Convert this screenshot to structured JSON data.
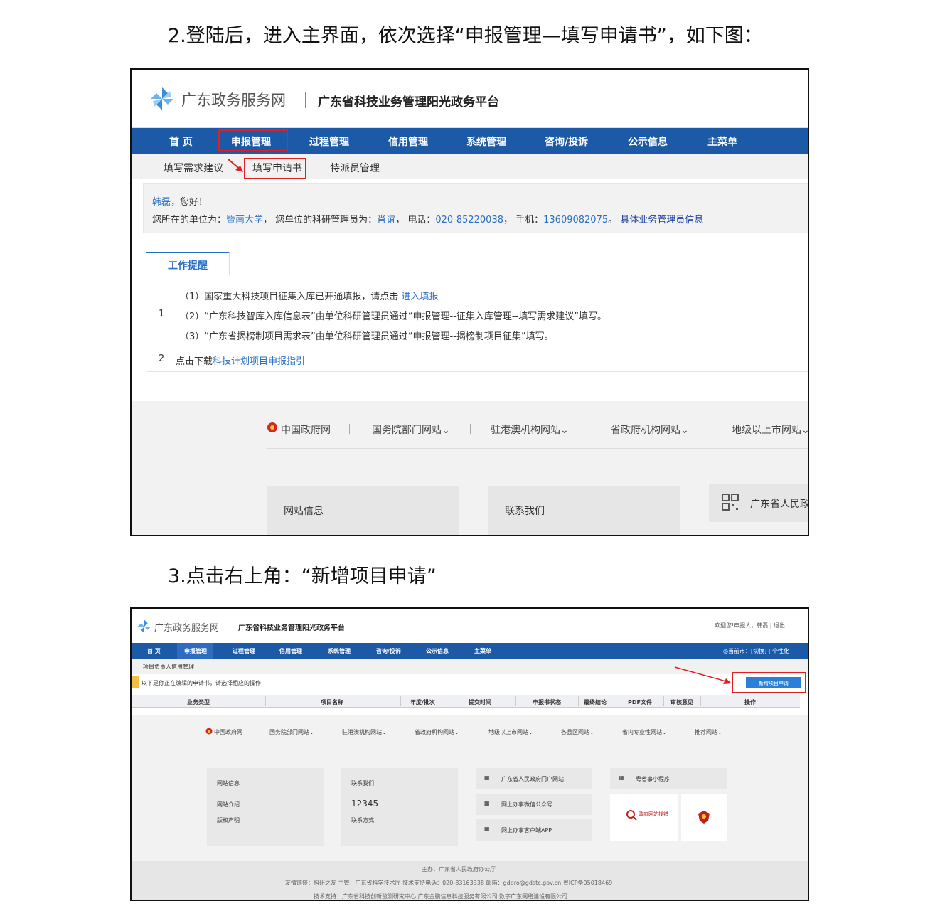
{
  "headings": {
    "step2": "2.登陆后，进入主界面，依次选择“申报管理—填写申请书”，如下图：",
    "step3": "3.点击右上角：“新增项目申请”"
  },
  "colors": {
    "nav": "#1c5aa8",
    "link": "#2a6fc6",
    "highlight": "#e02020"
  },
  "shot1": {
    "site_name": "广东政务服务网",
    "platform_name": "广东省科技业务管理阳光政务平台",
    "nav": [
      "首 页",
      "申报管理",
      "过程管理",
      "信用管理",
      "系统管理",
      "咨询/投诉",
      "公示信息",
      "主菜单"
    ],
    "subnav": [
      "填写需求建议",
      "填写申请书",
      "特派员管理"
    ],
    "greeting": {
      "name": "韩磊",
      "hello": "，您好！",
      "unit_label": "您所在的单位为：",
      "unit": "暨南大学",
      "admin_label": "，  您单位的科研管理员为：",
      "admin": "肖谊",
      "phone_label": "，  电话：",
      "phone": "020-85220038",
      "mobile_label": "，  手机：",
      "mobile": "13609082075",
      "end": "。",
      "link": "具体业务管理员信息"
    },
    "tab": "工作提醒",
    "notice": {
      "num1": "1",
      "r1": "（1）国家重大科技项目征集入库已开通填报，请点击 ",
      "r1_link": "进入填报",
      "r2": "（2）“广东科技智库入库信息表”由单位科研管理员通过“申报管理--征集入库管理--填写需求建议”填写。",
      "r3": "（3）“广东省揭榜制项目需求表”由单位科研管理员通过“申报管理--揭榜制项目征集”填写。",
      "num2": "2",
      "r4": "点击下载",
      "r4_link": "科技计划项目申报指引"
    },
    "footer_links": [
      "中国政府网",
      "国务院部门网站⌄",
      "驻港澳机构网站⌄",
      "省政府机构网站⌄",
      "地级以上市网站⌄"
    ],
    "cards": [
      "网站信息",
      "联系我们",
      "广东省人民政"
    ]
  },
  "shot2": {
    "site_name": "广东政务服务网",
    "platform_name": "广东省科技业务管理阳光政务平台",
    "user": "欢迎您!申报人，韩磊 | 退出",
    "nav": [
      "首 页",
      "申报管理",
      "过程管理",
      "信用管理",
      "系统管理",
      "咨询/投诉",
      "公示信息",
      "主菜单"
    ],
    "nav_right": "◎当前市：[切换] | 个性化",
    "breadcrumb": "项目负责人信用管理",
    "notice": "以下是你正在编辑的申请书，请选择相应的操作",
    "add_button": "新增项目申请",
    "columns": [
      "业务类型",
      "项目名称",
      "年度/批次",
      "提交时间",
      "申报书状态",
      "最终结论",
      "PDF文件",
      "审核意见",
      "操作"
    ],
    "footer_links": [
      "中国政府网",
      "国务院部门网站⌄",
      "驻港澳机构网站⌄",
      "省政府机构网站⌄",
      "地级以上市网站⌄",
      "各县区网站⌄",
      "省内专业性网站⌄",
      "推荐网站⌄"
    ],
    "site_info": {
      "title": "网站信息",
      "a": "网站介绍",
      "b": "版权声明"
    },
    "contact": {
      "title": "联系我们",
      "phone": "12345",
      "b": "联系方式"
    },
    "qr_items": [
      "广东省人民政府门户网站",
      "网上办事微信公众号",
      "网上办事客户端APP"
    ],
    "mini": "粤省事小程序",
    "badge": "政府网站找错",
    "bottom": {
      "host": "主办：广东省人民政府办公厅",
      "line2": "友情链接：科研之友    主管：广东省科学技术厅    技术支持电话：020-83163338    邮箱：gdpro@gdstc.gov.cn    粤ICP备05018469",
      "line3": "技术支持：广东省科技创新监测研究中心  广东金鹏信息科技服务有限公司  数字广东网络建设有限公司"
    }
  }
}
